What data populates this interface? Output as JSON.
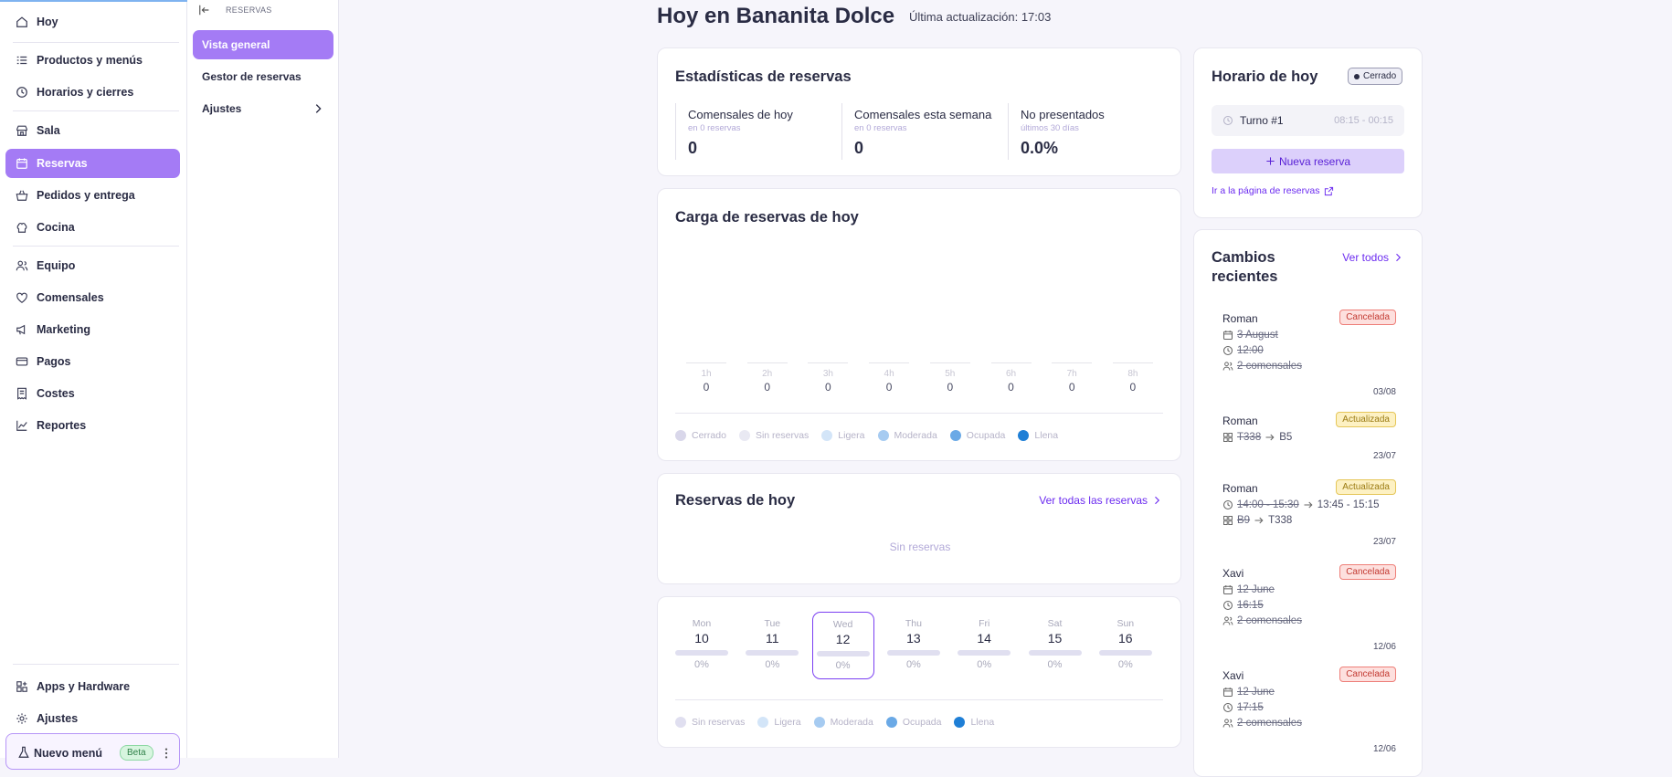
{
  "sidebar": {
    "items": [
      "Hoy",
      "Productos y menús",
      "Horarios y cierres",
      "Sala",
      "Reservas",
      "Pedidos y entrega",
      "Cocina",
      "Equipo",
      "Comensales",
      "Marketing",
      "Pagos",
      "Costes",
      "Reportes"
    ],
    "bottom": [
      "Apps y Hardware",
      "Ajustes"
    ],
    "new_menu": "Nuevo menú",
    "beta": "Beta"
  },
  "subnav": {
    "title": "RESERVAS",
    "items": [
      "Vista general",
      "Gestor de reservas",
      "Ajustes"
    ]
  },
  "header": {
    "title": "Hoy en Bananita Dolce",
    "updated": "Última actualización: 17:03"
  },
  "stats": {
    "title": "Estadísticas de reservas",
    "items": [
      {
        "label": "Comensales de hoy",
        "sub": "en 0 reservas",
        "value": "0"
      },
      {
        "label": "Comensales esta semana",
        "sub": "en 0 reservas",
        "value": "0"
      },
      {
        "label": "No presentados",
        "sub": "últimos 30 días",
        "value": "0.0%"
      }
    ]
  },
  "load": {
    "title": "Carga de reservas de hoy",
    "hours": [
      {
        "h": "1h",
        "n": "0"
      },
      {
        "h": "2h",
        "n": "0"
      },
      {
        "h": "3h",
        "n": "0"
      },
      {
        "h": "4h",
        "n": "0"
      },
      {
        "h": "5h",
        "n": "0"
      },
      {
        "h": "6h",
        "n": "0"
      },
      {
        "h": "7h",
        "n": "0"
      },
      {
        "h": "8h",
        "n": "0"
      }
    ],
    "legend": [
      {
        "label": "Cerrado",
        "color": "#d9d7ea"
      },
      {
        "label": "Sin reservas",
        "color": "#e9e9f3"
      },
      {
        "label": "Ligera",
        "color": "#d3e5f8"
      },
      {
        "label": "Moderada",
        "color": "#a6cbf1"
      },
      {
        "label": "Ocupada",
        "color": "#6aa9e6"
      },
      {
        "label": "Llena",
        "color": "#1f7fd6"
      }
    ]
  },
  "today": {
    "title": "Reservas de hoy",
    "link": "Ver todas las reservas",
    "empty": "Sin reservas"
  },
  "week": {
    "days": [
      {
        "name": "Mon",
        "date": "10",
        "pct": "0%"
      },
      {
        "name": "Tue",
        "date": "11",
        "pct": "0%"
      },
      {
        "name": "Wed",
        "date": "12",
        "pct": "0%"
      },
      {
        "name": "Thu",
        "date": "13",
        "pct": "0%"
      },
      {
        "name": "Fri",
        "date": "14",
        "pct": "0%"
      },
      {
        "name": "Sat",
        "date": "15",
        "pct": "0%"
      },
      {
        "name": "Sun",
        "date": "16",
        "pct": "0%"
      }
    ],
    "legend": [
      {
        "label": "Sin reservas",
        "color": "#e0dff0"
      },
      {
        "label": "Ligera",
        "color": "#d3e5f8"
      },
      {
        "label": "Moderada",
        "color": "#a6cbf1"
      },
      {
        "label": "Ocupada",
        "color": "#6aa9e6"
      },
      {
        "label": "Llena",
        "color": "#1f7fd6"
      }
    ]
  },
  "schedule": {
    "title": "Horario de hoy",
    "status": "Cerrado",
    "shift": "Turno #1",
    "shift_time": "08:15 - 00:15",
    "new_button": "Nueva reserva",
    "page_link": "Ir a la página de reservas"
  },
  "changes": {
    "title": "Cambios recientes",
    "link": "Ver todos",
    "entries": [
      {
        "name": "Roman",
        "badge": "Cancelada",
        "date": "03/08",
        "l1": "3 August",
        "l2": "12:00",
        "l3": "2 comensales"
      },
      {
        "name": "Roman",
        "badge": "Actualizada",
        "date": "23/07",
        "from": "T338",
        "to": "B5"
      },
      {
        "name": "Roman",
        "badge": "Actualizada",
        "date": "23/07",
        "time_from": "14:00 - 15:30",
        "time_to": "13:45 - 15:15",
        "from": "B9",
        "to": "T338"
      },
      {
        "name": "Xavi",
        "badge": "Cancelada",
        "date": "12/06",
        "l1": "12 June",
        "l2": "16:15",
        "l3": "2 comensales"
      },
      {
        "name": "Xavi",
        "badge": "Cancelada",
        "date": "12/06",
        "l1": "12 June",
        "l2": "17:15",
        "l3": "2 comensales"
      }
    ]
  }
}
